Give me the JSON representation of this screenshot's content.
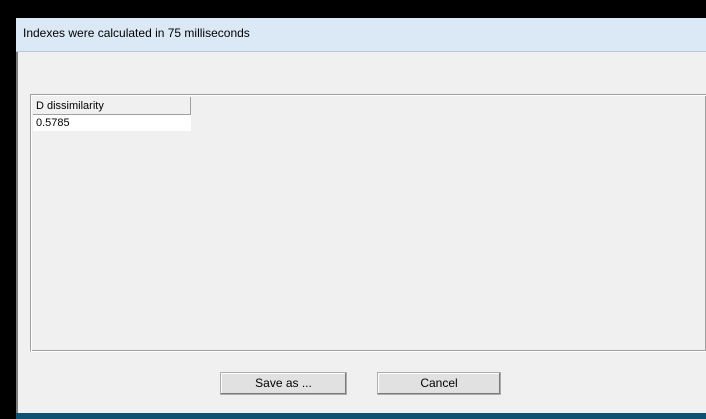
{
  "window": {
    "title": "Indexes were calculated in 75 milliseconds"
  },
  "results_grid": {
    "columns": [
      "D dissimilarity"
    ],
    "rows": [
      [
        "0.5785"
      ]
    ]
  },
  "buttons": {
    "save_as": "Save as ...",
    "cancel": "Cancel"
  }
}
